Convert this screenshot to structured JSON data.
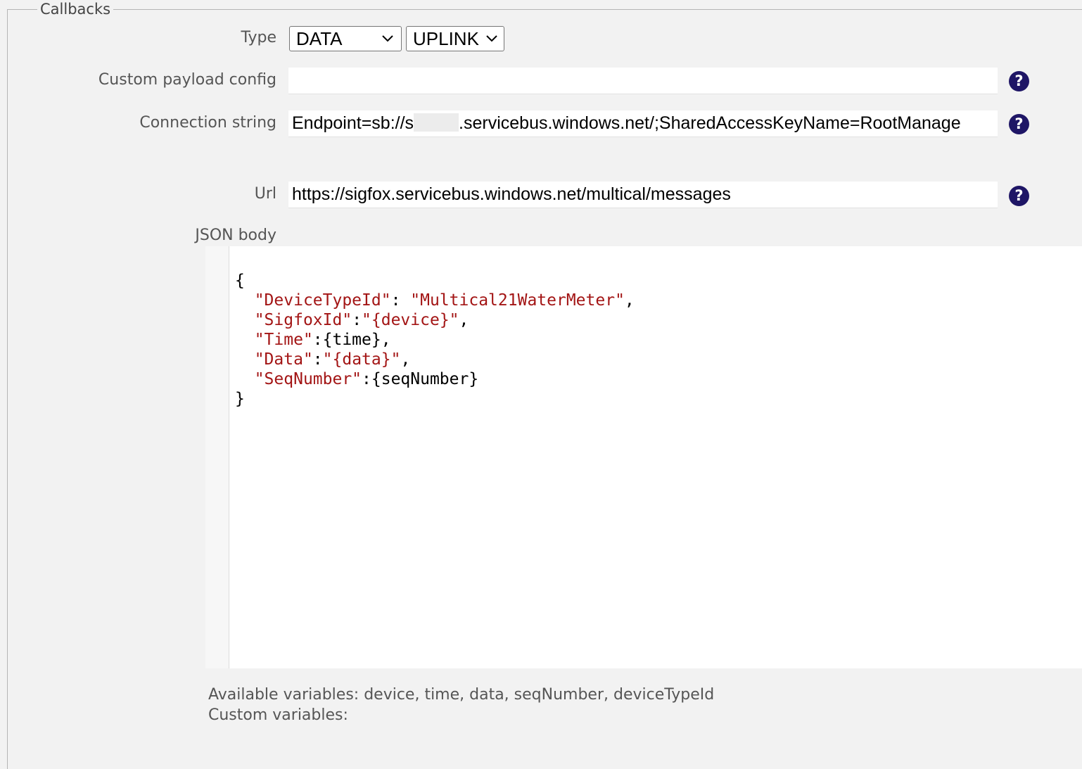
{
  "legend": "Callbacks",
  "type_row": {
    "label": "Type",
    "type_value": "DATA",
    "direction_value": "UPLINK"
  },
  "custom_payload": {
    "label": "Custom payload config",
    "value": ""
  },
  "connection": {
    "label": "Connection string",
    "value_prefix": "Endpoint=sb://s",
    "value_suffix": ".servicebus.windows.net/;SharedAccessKeyName=RootManage"
  },
  "url": {
    "label": "Url",
    "value": "https://sigfox.servicebus.windows.net/multical/messages"
  },
  "json_body": {
    "label": "JSON body",
    "lines": [
      [
        {
          "t": "{",
          "s": false
        }
      ],
      [
        {
          "t": "  ",
          "s": false
        },
        {
          "t": "\"DeviceTypeId\"",
          "s": true
        },
        {
          "t": ": ",
          "s": false
        },
        {
          "t": "\"Multical21WaterMeter\"",
          "s": true
        },
        {
          "t": ",",
          "s": false
        }
      ],
      [
        {
          "t": "  ",
          "s": false
        },
        {
          "t": "\"SigfoxId\"",
          "s": true
        },
        {
          "t": ":",
          "s": false
        },
        {
          "t": "\"{device}\"",
          "s": true
        },
        {
          "t": ",",
          "s": false
        }
      ],
      [
        {
          "t": "  ",
          "s": false
        },
        {
          "t": "\"Time\"",
          "s": true
        },
        {
          "t": ":{time},",
          "s": false
        }
      ],
      [
        {
          "t": "  ",
          "s": false
        },
        {
          "t": "\"Data\"",
          "s": true
        },
        {
          "t": ":",
          "s": false
        },
        {
          "t": "\"{data}\"",
          "s": true
        },
        {
          "t": ",",
          "s": false
        }
      ],
      [
        {
          "t": "  ",
          "s": false
        },
        {
          "t": "\"SeqNumber\"",
          "s": true
        },
        {
          "t": ":{seqNumber}",
          "s": false
        }
      ],
      [
        {
          "t": "}",
          "s": false
        }
      ]
    ]
  },
  "help_glyph": "?",
  "icons": {
    "help": "question-circle-icon",
    "dropdown": "chevron-down-icon"
  },
  "colors": {
    "help_icon": "#1f1666",
    "json_string": "#a31515"
  },
  "available_variables": "Available variables: device, time, data, seqNumber, deviceTypeId",
  "custom_variables": "Custom variables:"
}
